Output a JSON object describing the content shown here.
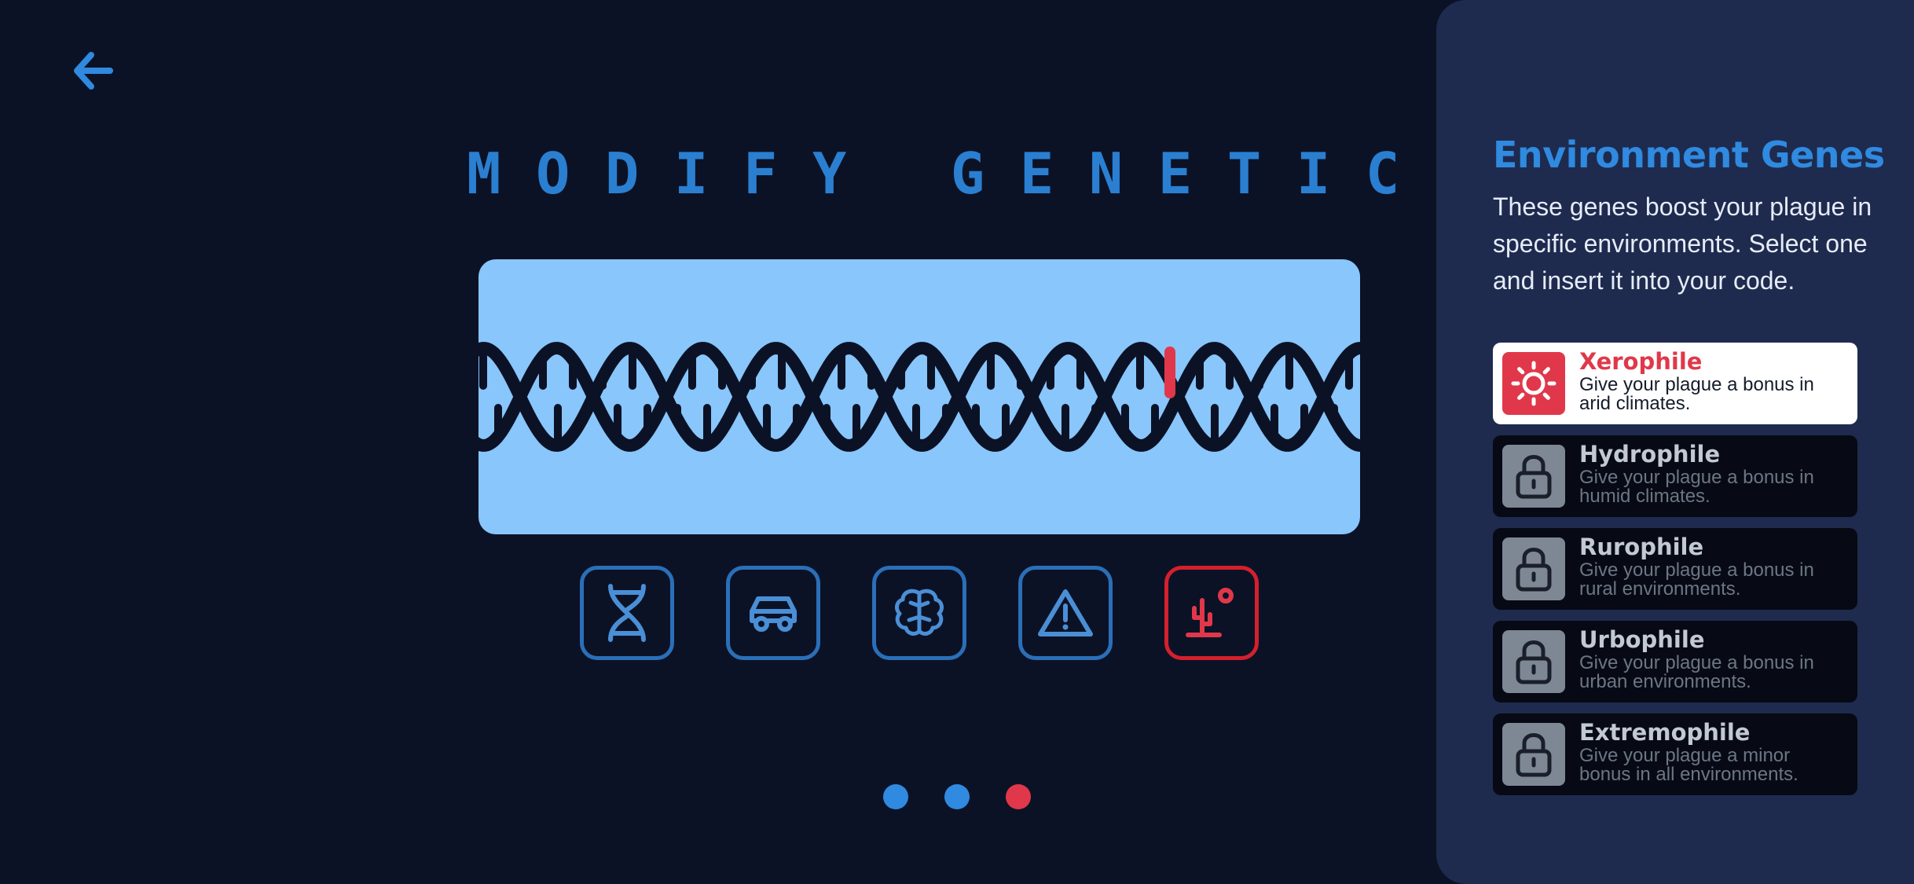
{
  "header": {
    "title": "MODIFY GENETICS",
    "back_icon": "arrow-left-icon"
  },
  "gene_slots": [
    {
      "icon": "dna-icon",
      "color": "#4a8fd6",
      "active": false
    },
    {
      "icon": "car-icon",
      "color": "#4a8fd6",
      "active": false
    },
    {
      "icon": "brain-icon",
      "color": "#4a8fd6",
      "active": false
    },
    {
      "icon": "warning-icon",
      "color": "#4a8fd6",
      "active": false
    },
    {
      "icon": "desert-icon",
      "color": "#e0384a",
      "active": true
    }
  ],
  "pagination": {
    "total": 3,
    "current": 3
  },
  "sidebar": {
    "title": "Environment Genes",
    "description": "These genes boost your plague in specific environments. Select one and insert it into your code.",
    "genes": [
      {
        "name": "Xerophile",
        "description": "Give your plague a bonus in arid climates.",
        "icon": "sun-icon",
        "selected": true,
        "locked": false
      },
      {
        "name": "Hydrophile",
        "description": "Give your plague a bonus in humid climates.",
        "icon": "lock-icon",
        "selected": false,
        "locked": true
      },
      {
        "name": "Rurophile",
        "description": "Give your plague a bonus in rural environments.",
        "icon": "lock-icon",
        "selected": false,
        "locked": true
      },
      {
        "name": "Urbophile",
        "description": "Give your plague a bonus in urban environments.",
        "icon": "lock-icon",
        "selected": false,
        "locked": true
      },
      {
        "name": "Extremophile",
        "description": "Give your plague a minor bonus in all environments.",
        "icon": "lock-icon",
        "selected": false,
        "locked": true
      }
    ]
  },
  "colors": {
    "background": "#0c1226",
    "accent_blue": "#2f8ae0",
    "accent_red": "#e0384a",
    "dna_panel": "#88c6fb",
    "sidebar": "#1e2b4e"
  }
}
